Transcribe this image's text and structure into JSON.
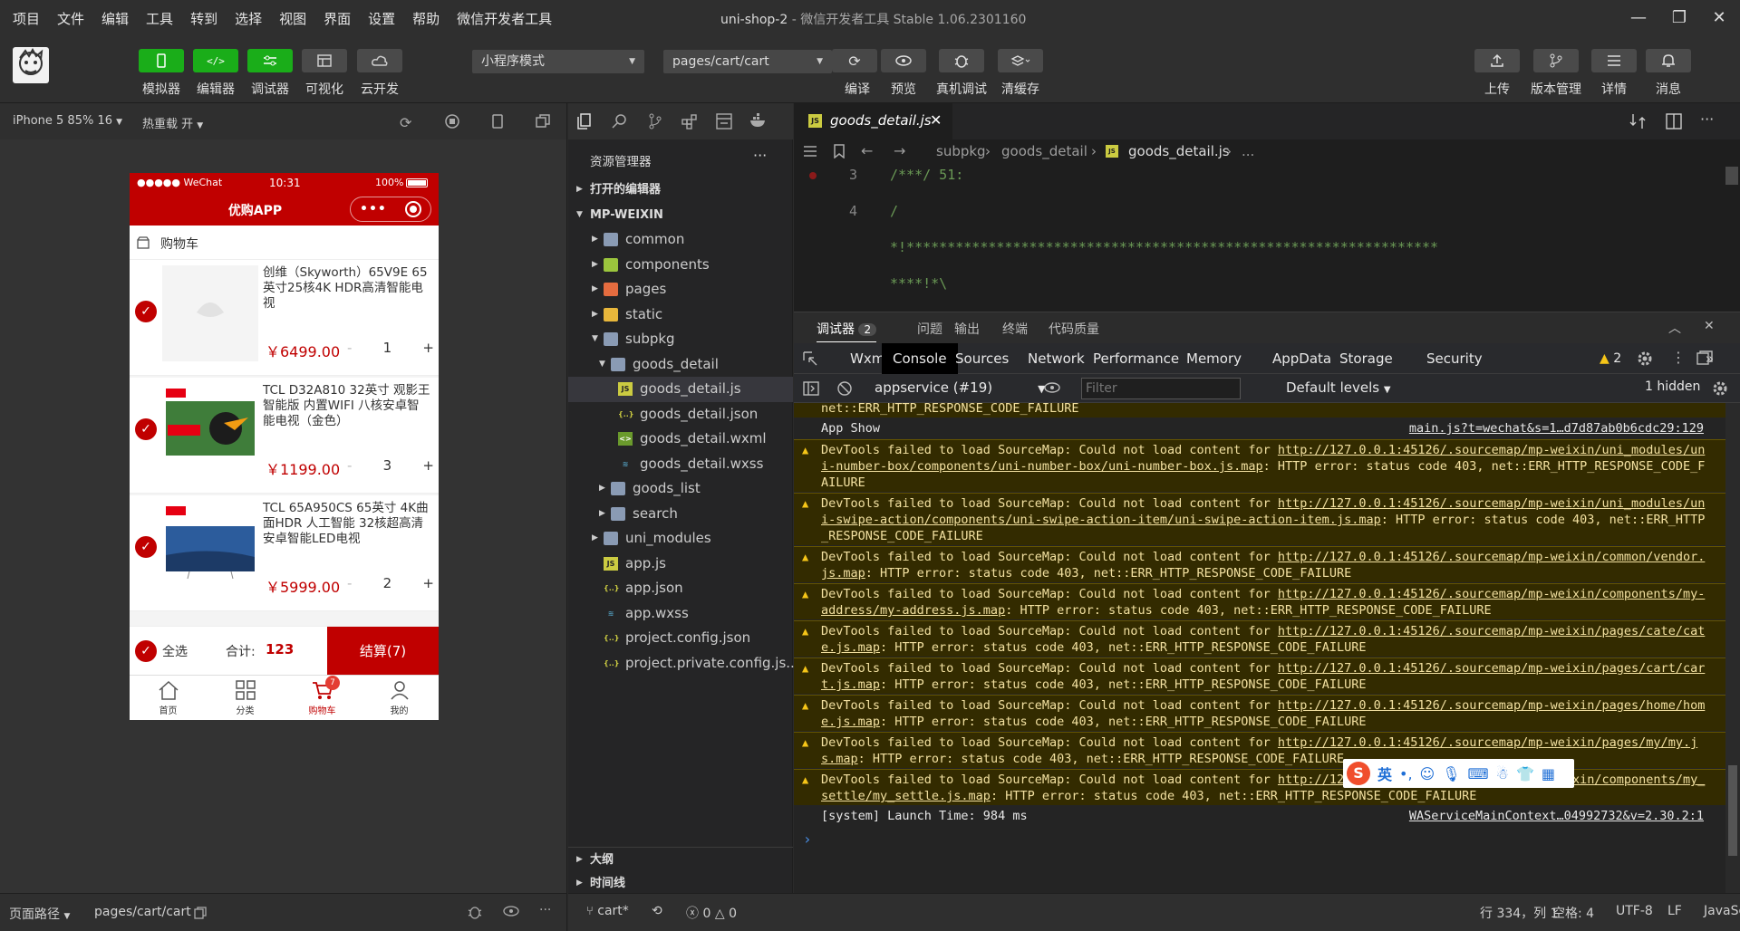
{
  "titlebar": {
    "menu": [
      "项目",
      "文件",
      "编辑",
      "工具",
      "转到",
      "选择",
      "视图",
      "界面",
      "设置",
      "帮助",
      "微信开发者工具"
    ],
    "project": "uni-shop-2",
    "subtitle": "- 微信开发者工具 Stable 1.06.2301160"
  },
  "toolbar": {
    "left_buttons": [
      "模拟器",
      "编辑器",
      "调试器",
      "可视化",
      "云开发"
    ],
    "mode_select": "小程序模式",
    "page_select": "pages/cart/cart",
    "mid_buttons": [
      "编译",
      "预览",
      "真机调试",
      "清缓存"
    ],
    "right_buttons": [
      "上传",
      "版本管理",
      "详情",
      "消息"
    ]
  },
  "simulator": {
    "device": "iPhone 5 85% 16",
    "hotreload": "热重载 开",
    "status": {
      "carrier": "●●●●● WeChat",
      "time": "10:31",
      "battery": "100%"
    },
    "nav_title": "优购APP",
    "section_title": "购物车",
    "items": [
      {
        "title": "创维（Skyworth）65V9E 65英寸25核4K HDR高清智能电视",
        "price": "￥6499.00",
        "qty": "1"
      },
      {
        "title": "TCL D32A810 32英寸 观影王 智能版 内置WIFI 八核安卓智能电视（金色）",
        "price": "￥1199.00",
        "qty": "3"
      },
      {
        "title": "TCL 65A950CS 65英寸 4K曲面HDR 人工智能 32核超高清安卓智能LED电视",
        "price": "￥5999.00",
        "qty": "2"
      }
    ],
    "qty_minus": "-",
    "qty_plus": "+",
    "settle": {
      "select_all": "全选",
      "total_label": "合计:",
      "total": "123",
      "checkout": "结算(7)"
    },
    "tabs": [
      "首页",
      "分类",
      "购物车",
      "我的"
    ],
    "cart_badge": "7"
  },
  "left_footer": {
    "label": "页面路径",
    "path": "pages/cart/cart"
  },
  "explorer": {
    "title": "资源管理器",
    "more": "···",
    "open_editors": "打开的编辑器",
    "root": "MP-WEIXIN",
    "tree": [
      {
        "name": "common",
        "kind": "folder"
      },
      {
        "name": "components",
        "kind": "folder"
      },
      {
        "name": "pages",
        "kind": "folder"
      },
      {
        "name": "static",
        "kind": "folder"
      },
      {
        "name": "subpkg",
        "kind": "folder-open"
      },
      {
        "name": "goods_detail",
        "kind": "folder-open"
      },
      {
        "name": "goods_detail.js",
        "kind": "js"
      },
      {
        "name": "goods_detail.json",
        "kind": "json"
      },
      {
        "name": "goods_detail.wxml",
        "kind": "wxml"
      },
      {
        "name": "goods_detail.wxss",
        "kind": "wxss"
      },
      {
        "name": "goods_list",
        "kind": "folder"
      },
      {
        "name": "search",
        "kind": "folder"
      },
      {
        "name": "uni_modules",
        "kind": "folder"
      },
      {
        "name": "app.js",
        "kind": "js"
      },
      {
        "name": "app.json",
        "kind": "json"
      },
      {
        "name": "app.wxss",
        "kind": "wxss"
      },
      {
        "name": "project.config.json",
        "kind": "json"
      },
      {
        "name": "project.private.config.js...",
        "kind": "json"
      }
    ],
    "outline": "大纲",
    "timeline": "时间线"
  },
  "editor": {
    "tab": "goods_detail.js",
    "crumbs": [
      "subpkg",
      "goods_detail",
      "goods_detail.js",
      "..."
    ],
    "lines": [
      {
        "n": "3",
        "code": "/***/ 51:"
      },
      {
        "n": "4",
        "code": "/"
      },
      {
        "n": "",
        "code": "*!*****************************************************************"
      },
      {
        "n": "",
        "code": "****!*\\"
      }
    ]
  },
  "debugger": {
    "tabs": [
      "调试器",
      "问题",
      "输出",
      "终端",
      "代码质量"
    ],
    "badge": "2",
    "devtools_tabs": [
      "Wxml",
      "Console",
      "Sources",
      "Network",
      "Performance",
      "Memory",
      "AppData",
      "Storage",
      "Security"
    ],
    "more": "»",
    "warn_count": "2",
    "context": "appservice (#19)",
    "filter_placeholder": "Filter",
    "levels": "Default levels",
    "hidden": "1 hidden",
    "messages": [
      {
        "type": "warn",
        "text": "net::ERR_HTTP_RESPONSE_CODE_FAILURE",
        "lines": 1,
        "partial": true
      },
      {
        "type": "info",
        "text": "App Show",
        "src": "main.js?t=wechat&s=1…d7d87ab0b6cdc29:129",
        "lines": 1
      },
      {
        "type": "warn",
        "pre": "DevTools failed to load SourceMap: Could not load content for ",
        "link": "http://127.0.0.1:45126/.sourcemap/mp-weixin/uni_modules/uni-number-box/components/uni-number-box/uni-number-box.js.map",
        "post": ": HTTP error: status code 403, net::ERR_HTTP_RESPONSE_CODE_FAILURE",
        "lines": 3
      },
      {
        "type": "warn",
        "pre": "DevTools failed to load SourceMap: Could not load content for ",
        "link": "http://127.0.0.1:45126/.sourcemap/mp-weixin/uni_modules/uni-swipe-action/components/uni-swipe-action-item/uni-swipe-action-item.js.map",
        "post": ": HTTP error: status code 403, net::ERR_HTTP_RESPONSE_CODE_FAILURE",
        "lines": 3
      },
      {
        "type": "warn",
        "pre": "DevTools failed to load SourceMap: Could not load content for ",
        "link": "http://127.0.0.1:45126/.sourcemap/mp-weixin/common/vendor.js.map",
        "post": ": HTTP error: status code 403, net::ERR_HTTP_RESPONSE_CODE_FAILURE",
        "lines": 2
      },
      {
        "type": "warn",
        "pre": "DevTools failed to load SourceMap: Could not load content for ",
        "link": "http://127.0.0.1:45126/.sourcemap/mp-weixin/components/my-address/my-address.js.map",
        "post": ": HTTP error: status code 403, net::ERR_HTTP_RESPONSE_CODE_FAILURE",
        "lines": 2
      },
      {
        "type": "warn",
        "pre": "DevTools failed to load SourceMap: Could not load content for ",
        "link": "http://127.0.0.1:45126/.sourcemap/mp-weixin/pages/cate/cate.js.map",
        "post": ": HTTP error: status code 403, net::ERR_HTTP_RESPONSE_CODE_FAILURE",
        "lines": 2
      },
      {
        "type": "warn",
        "pre": "DevTools failed to load SourceMap: Could not load content for ",
        "link": "http://127.0.0.1:45126/.sourcemap/mp-weixin/pages/cart/cart.js.map",
        "post": ": HTTP error: status code 403, net::ERR_HTTP_RESPONSE_CODE_FAILURE",
        "lines": 2
      },
      {
        "type": "warn",
        "pre": "DevTools failed to load SourceMap: Could not load content for ",
        "link": "http://127.0.0.1:45126/.sourcemap/mp-weixin/pages/home/home.js.map",
        "post": ": HTTP error: status code 403, net::ERR_HTTP_RESPONSE_CODE_FAILURE",
        "lines": 2
      },
      {
        "type": "warn",
        "pre": "DevTools failed to load SourceMap: Could not load content for ",
        "link": "http://127.0.0.1:45126/.sourcemap/mp-weixin/pages/my/my.js.map",
        "post": ": HTTP error: status code 403, net::ERR_HTTP_RESPONSE_CODE_FAILURE",
        "lines": 2
      },
      {
        "type": "warn",
        "pre": "DevTools failed to load SourceMap: Could not load content for ",
        "link": "http://127.0.0.1:45126/.sourcemap/mp-weixin/components/my_settle/my_settle.js.map",
        "post": ": HTTP error: status code 403, net::ERR_HTTP_RESPONSE_CODE_FAILURE",
        "lines": 2
      },
      {
        "type": "info",
        "text": "[system] Launch Time: 984 ms",
        "src": "WAServiceMainContext…04992732&v=2.30.2:1",
        "lines": 1
      }
    ],
    "prompt": "›"
  },
  "statusbar": {
    "branch": "cart*",
    "errors": "0",
    "warnings": "0",
    "position": "行 334，列 1",
    "spaces": "空格: 4",
    "encoding": "UTF-8",
    "eol": "LF",
    "language": "JavaScript"
  },
  "ime": {
    "logo": "S",
    "lang": "英"
  },
  "colors": {
    "accent_green": "#1aad19",
    "cart_red": "#c00000",
    "warn_bg": "#332b00"
  }
}
